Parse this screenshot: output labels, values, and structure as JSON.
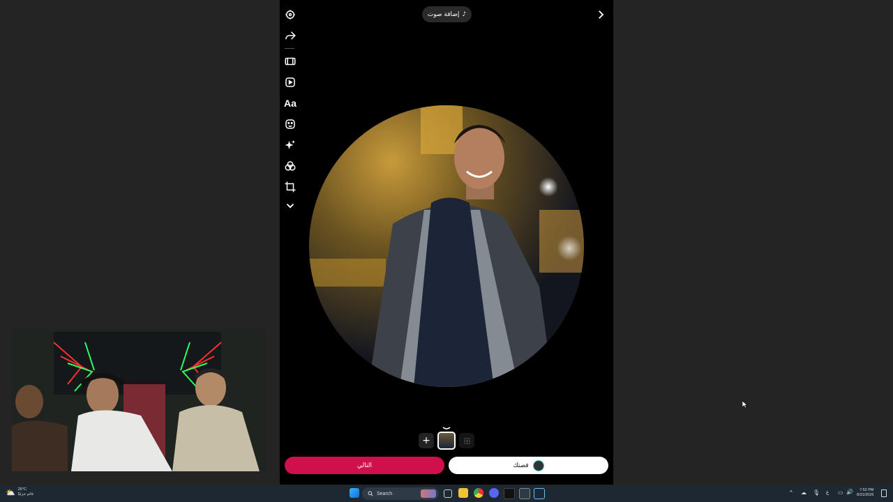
{
  "editor": {
    "add_audio_label": "إضافة صوت",
    "tools": [
      "settings-icon",
      "share-icon",
      "reel-frame-icon",
      "clip-icon",
      "Aa",
      "sticker-icon",
      "effects-sparkle-icon",
      "filters-icon",
      "crop-icon",
      "more-chevron-icon"
    ],
    "text_tool_label": "Aa",
    "next_button_label": "التالي",
    "story_button_label": "قصتك",
    "accent_color": "#d0104c"
  },
  "taskbar": {
    "weather_temp": "26°C",
    "weather_desc": "غائم جزئيًا",
    "search_placeholder": "Search",
    "time": "7:52 PM",
    "date": "8/31/2026",
    "lang": "ع"
  }
}
